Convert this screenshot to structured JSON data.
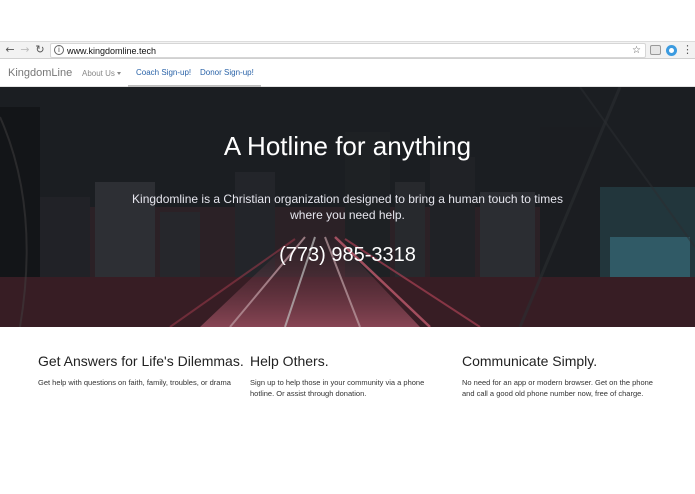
{
  "browser": {
    "url": "www.kingdomline.tech",
    "icons": [
      "back-icon",
      "forward-icon",
      "reload-icon",
      "info-icon",
      "star-icon",
      "extension-icon",
      "extension-icon",
      "menu-icon"
    ]
  },
  "nav": {
    "brand": "KingdomLine",
    "about": "About Us",
    "coach": "Coach Sign-up!",
    "donor": "Donor Sign-up!"
  },
  "hero": {
    "title": "A Hotline for anything",
    "subtitle": "Kingdomline is a Christian organization designed to bring a human touch to times where you need help.",
    "phone": "(773) 985-3318"
  },
  "features": [
    {
      "title": "Get Answers for Life's Dilemmas.",
      "text": "Get help with questions on faith, family, troubles, or drama"
    },
    {
      "title": "Help Others.",
      "text": "Sign up to help those in your community via a phone hotline. Or assist through donation."
    },
    {
      "title": "Communicate Simply.",
      "text": "No need for an app or modern browser. Get on the phone and call a good old phone number now, free of charge."
    }
  ],
  "colors": {
    "link": "#2a63a8",
    "brand": "#777777"
  }
}
